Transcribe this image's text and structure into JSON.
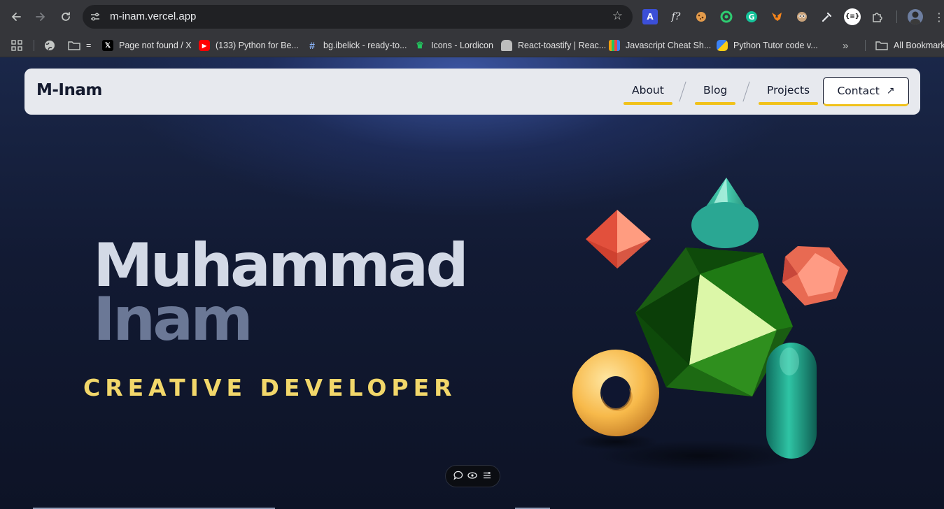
{
  "browser": {
    "url": "m-inam.vercel.app",
    "bookmarks": [
      {
        "label": "Page not found / X",
        "icon": "x-logo-icon",
        "color": "#ffffff"
      },
      {
        "label": "(133) Python for Be...",
        "icon": "youtube-icon",
        "color": "#ff0000"
      },
      {
        "label": "bg.ibelick - ready-to...",
        "icon": "hash-icon",
        "color": "#8ab4f8"
      },
      {
        "label": "Icons - Lordicon",
        "icon": "crown-icon",
        "color": "#22c55e"
      },
      {
        "label": "React-toastify | Reac...",
        "icon": "bread-icon",
        "color": "#d0d0d0"
      },
      {
        "label": "Javascript Cheat Sh...",
        "icon": "stripes-icon",
        "color": "#f59e0b"
      },
      {
        "label": "Python Tutor code v...",
        "icon": "python-icon",
        "color": "#3b82f6"
      }
    ],
    "all_bookmarks": "All Bookmarks",
    "folder_label": "="
  },
  "site": {
    "logo": "M-Inam",
    "nav": {
      "about": "About",
      "blog": "Blog",
      "projects": "Projects",
      "contact": "Contact",
      "contact_icon": "↗"
    },
    "hero": {
      "first_name": "Muhammad",
      "last_name": "Inam",
      "role": "CREATIVE DEVELOPER"
    }
  },
  "colors": {
    "accent": "#f1c21b",
    "role_text": "#f2d76a",
    "navbar_bg": "#e7e9ee"
  }
}
